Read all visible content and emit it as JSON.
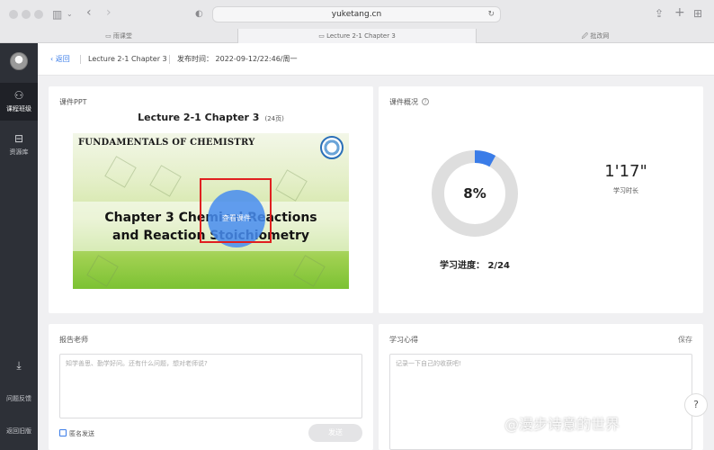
{
  "browser": {
    "url": "yuketang.cn",
    "tabs": [
      {
        "icon": "▭",
        "label": "雨课堂"
      },
      {
        "icon": "▭",
        "label": "Lecture 2-1 Chapter 3"
      },
      {
        "icon": "🖉",
        "label": "批改网"
      }
    ]
  },
  "sidebar": {
    "items": [
      {
        "label": "课程班级",
        "icon": "class-icon"
      },
      {
        "label": "资源库",
        "icon": "library-icon"
      },
      {
        "label": "问题反馈",
        "icon": "download-icon"
      },
      {
        "label": "返回旧版",
        "icon": ""
      }
    ]
  },
  "header": {
    "back_label": "返回",
    "lecture_title": "Lecture 2-1 Chapter 3",
    "publish_time": "发布时间： 2022-09-12/22:46/周一"
  },
  "ppt": {
    "section_title": "课件PPT",
    "heading": "Lecture 2-1 Chapter 3",
    "pages": "(24页)",
    "slide_top_text": "FUNDAMENTALS OF CHEMISTRY",
    "slide_line1": "Chapter 3   Chemical Reactions",
    "slide_line2": "and Reaction Stoichiometry",
    "view_button": "查看课件"
  },
  "stats": {
    "section_title": "课件概况",
    "percent_text": "8%",
    "percent_value": 8,
    "duration": "1'17\"",
    "duration_label": "学习时长",
    "progress_text": "学习进度： 2/24"
  },
  "report": {
    "section_title": "报告老师",
    "placeholder": "知学善思、勤学好问。还有什么问题，想对老师说?",
    "anonymous_label": "匿名发送",
    "send_button": "发送"
  },
  "notes": {
    "section_title": "学习心得",
    "save_label": "保存",
    "placeholder": "记录一下自己的收获吧!"
  },
  "help_button": "?",
  "watermark": "@漫步诗意的世界",
  "colors": {
    "accent": "#3a7ce8",
    "sidebar_bg": "#2d3037",
    "donut_track": "#dedede",
    "donut_fill": "#3a7ce8"
  }
}
